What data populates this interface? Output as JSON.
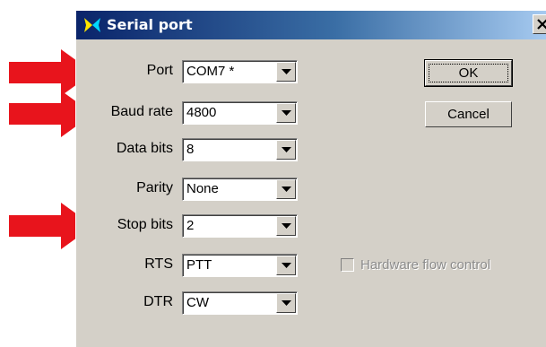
{
  "window": {
    "title": "Serial port",
    "close_glyph": "X",
    "accent_color": "#0a246a"
  },
  "fields": [
    {
      "label": "Port",
      "value": "COM7 *"
    },
    {
      "label": "Baud rate",
      "value": "4800"
    },
    {
      "label": "Data bits",
      "value": "8"
    },
    {
      "label": "Parity",
      "value": "None"
    },
    {
      "label": "Stop bits",
      "value": "2"
    },
    {
      "label": "RTS",
      "value": "PTT"
    },
    {
      "label": "DTR",
      "value": "CW"
    }
  ],
  "buttons": {
    "ok": "OK",
    "cancel": "Cancel"
  },
  "hardware_flow_control": {
    "label": "Hardware flow control",
    "checked": false,
    "enabled": false
  },
  "annotations": {
    "arrow_color": "#e8141c",
    "highlighted_fields": [
      "Port",
      "Baud rate",
      "Stop bits"
    ]
  }
}
